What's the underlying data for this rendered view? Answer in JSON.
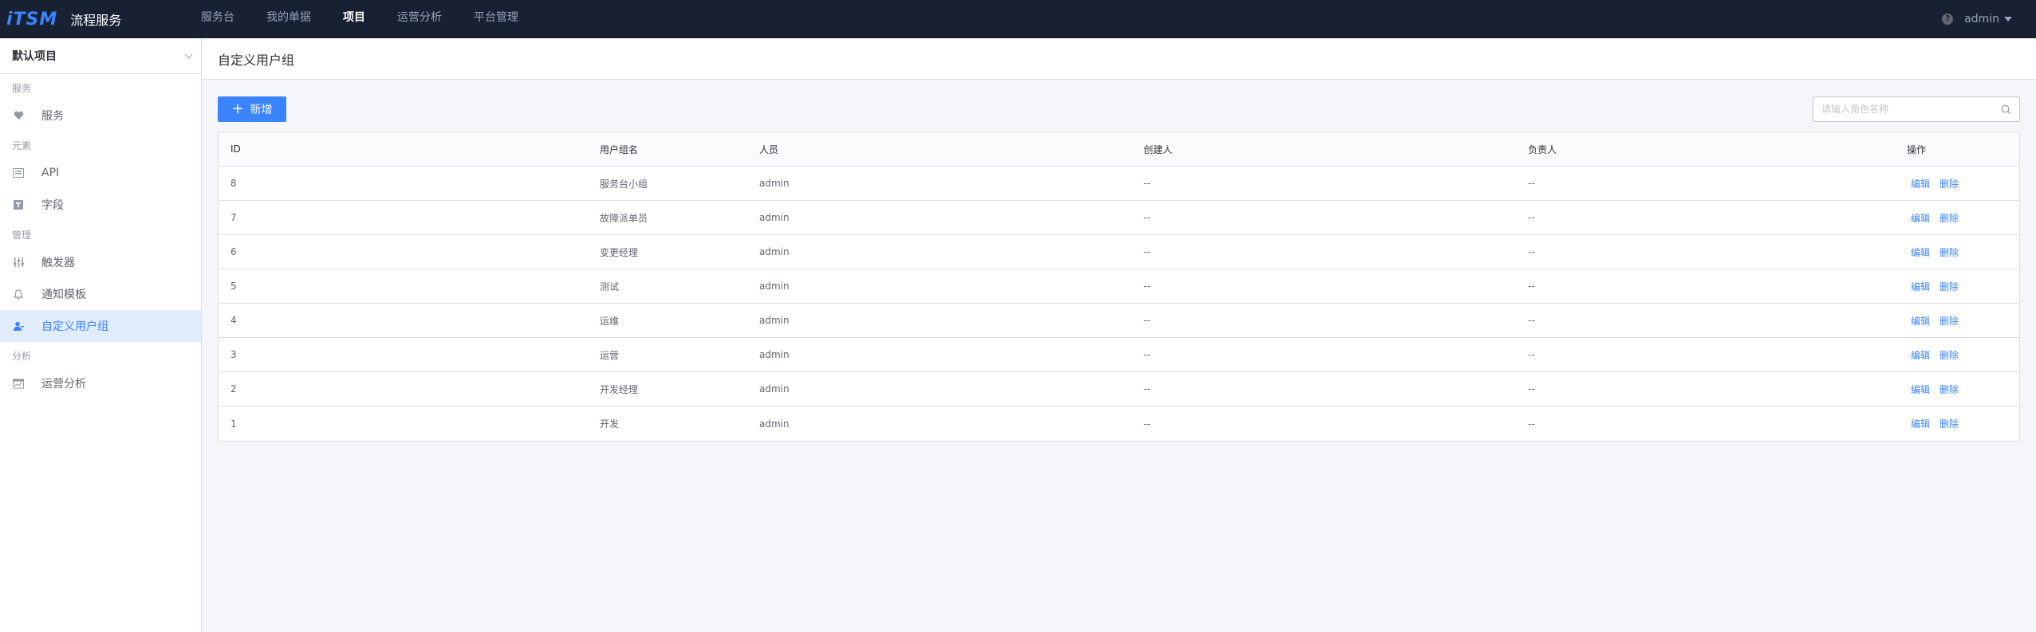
{
  "app": {
    "logo": "iTSM",
    "name": "流程服务"
  },
  "nav": [
    "服务台",
    "我的单据",
    "项目",
    "运营分析",
    "平台管理"
  ],
  "nav_active_index": 2,
  "user": {
    "name": "admin"
  },
  "sidebar": {
    "project": "默认项目",
    "groups": [
      {
        "title": "服务",
        "items": [
          {
            "label": "服务",
            "icon": "heart-icon"
          }
        ]
      },
      {
        "title": "元素",
        "items": [
          {
            "label": "API",
            "icon": "api-icon"
          },
          {
            "label": "字段",
            "icon": "field-icon"
          }
        ]
      },
      {
        "title": "管理",
        "items": [
          {
            "label": "触发器",
            "icon": "trigger-icon"
          },
          {
            "label": "通知模板",
            "icon": "bell-icon"
          },
          {
            "label": "自定义用户组",
            "icon": "user-group-icon",
            "active": true
          }
        ]
      },
      {
        "title": "分析",
        "items": [
          {
            "label": "运营分析",
            "icon": "chart-icon"
          }
        ]
      }
    ]
  },
  "page": {
    "title": "自定义用户组",
    "add_label": "新增",
    "search_placeholder": "请输入角色名称"
  },
  "table": {
    "headers": [
      "ID",
      "用户组名",
      "人员",
      "创建人",
      "负责人",
      "操作"
    ],
    "actions": [
      "编辑",
      "删除"
    ],
    "rows": [
      {
        "id": "8",
        "name": "服务台小组",
        "member": "admin",
        "creator": "--",
        "owner": "--"
      },
      {
        "id": "7",
        "name": "故障派单员",
        "member": "admin",
        "creator": "--",
        "owner": "--"
      },
      {
        "id": "6",
        "name": "变更经理",
        "member": "admin",
        "creator": "--",
        "owner": "--"
      },
      {
        "id": "5",
        "name": "测试",
        "member": "admin",
        "creator": "--",
        "owner": "--"
      },
      {
        "id": "4",
        "name": "运维",
        "member": "admin",
        "creator": "--",
        "owner": "--"
      },
      {
        "id": "3",
        "name": "运营",
        "member": "admin",
        "creator": "--",
        "owner": "--"
      },
      {
        "id": "2",
        "name": "开发经理",
        "member": "admin",
        "creator": "--",
        "owner": "--"
      },
      {
        "id": "1",
        "name": "开发",
        "member": "admin",
        "creator": "--",
        "owner": "--"
      }
    ]
  },
  "colors": {
    "accent": "#3a84ff",
    "topbar": "#182132",
    "active_bg": "#e1ecff"
  }
}
